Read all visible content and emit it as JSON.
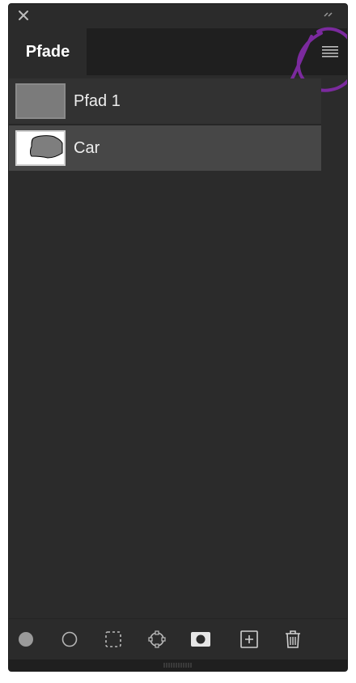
{
  "panel": {
    "tab_label": "Pfade",
    "close_icon": "close-icon",
    "collapse_icon": "double-chevron-icon",
    "menu_icon": "hamburger-menu-icon",
    "annotation_color": "#7b2a9e"
  },
  "paths": [
    {
      "label": "Pfad 1",
      "thumbnail": "gray-filled",
      "selected": false
    },
    {
      "label": "Car",
      "thumbnail": "car-silhouette",
      "selected": true
    }
  ],
  "toolbar": {
    "items": [
      {
        "icon": "fill-path-icon"
      },
      {
        "icon": "stroke-path-icon"
      },
      {
        "icon": "load-as-selection-icon"
      },
      {
        "icon": "make-work-path-icon"
      },
      {
        "icon": "add-mask-icon"
      },
      {
        "icon": "new-path-icon"
      },
      {
        "icon": "delete-path-icon"
      }
    ]
  },
  "colors": {
    "panel_bg": "#2b2b2b",
    "row_selected": "#474747",
    "text": "#ededed"
  }
}
